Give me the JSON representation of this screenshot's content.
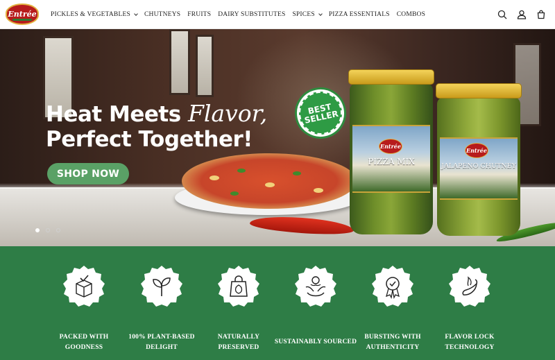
{
  "brand": {
    "logo_text": "Entrée"
  },
  "nav": {
    "items": [
      {
        "label": "PICKLES & VEGETABLES",
        "has_dropdown": true
      },
      {
        "label": "CHUTNEYS",
        "has_dropdown": false
      },
      {
        "label": "FRUITS",
        "has_dropdown": false
      },
      {
        "label": "DAIRY SUBSTITUTES",
        "has_dropdown": false
      },
      {
        "label": "SPICES",
        "has_dropdown": true
      },
      {
        "label": "PIZZA ESSENTIALS",
        "has_dropdown": false
      },
      {
        "label": "COMBOS",
        "has_dropdown": false
      }
    ],
    "icons": [
      "search-icon",
      "account-icon",
      "cart-icon"
    ]
  },
  "hero": {
    "headline_part1": "Heat Meets",
    "headline_flavor": "Flavor,",
    "headline_part2": "Perfect Together!",
    "cta_label": "SHOP NOW",
    "badge_text_line1": "BEST",
    "badge_text_line2": "SELLER",
    "jar1": {
      "logo": "Entrée",
      "name": "PIZZA MIX"
    },
    "jar2": {
      "logo": "Entrée",
      "name": "JALAPENO CHUTNEY"
    },
    "slides": {
      "count": 3,
      "active": 1
    }
  },
  "features": [
    {
      "icon": "package-check-icon",
      "line1": "PACKED WITH",
      "line2": "GOODNESS"
    },
    {
      "icon": "sprout-icon",
      "line1": "100% PLANT-BASED",
      "line2": "DELIGHT"
    },
    {
      "icon": "eco-bag-icon",
      "line1": "NATURALLY",
      "line2": "PRESERVED"
    },
    {
      "icon": "sustainable-hands-icon",
      "line1": "SUSTAINABLY SOURCED",
      "line2": ""
    },
    {
      "icon": "award-badge-icon",
      "line1": "BURSTING WITH",
      "line2": "AUTHENTICITY"
    },
    {
      "icon": "chili-flame-icon",
      "line1": "FLAVOR LOCK",
      "line2": "TECHNOLOGY"
    }
  ],
  "colors": {
    "brand_green": "#2e7d46",
    "cta_green": "#5aa166",
    "logo_red": "#b71c1c",
    "lid_gold": "#e3b341"
  }
}
